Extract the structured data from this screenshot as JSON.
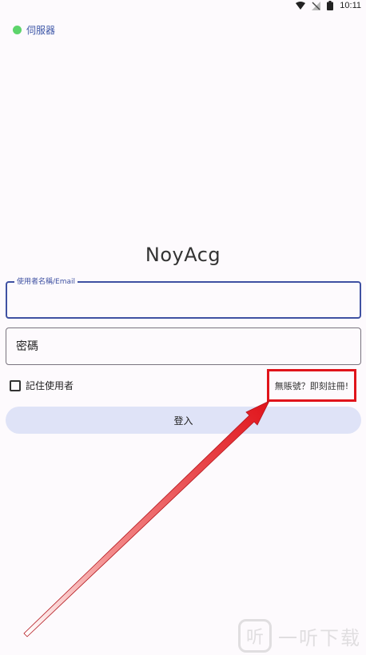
{
  "status_bar": {
    "time": "10:11",
    "icons": [
      "wifi-icon",
      "no-signal-icon",
      "battery-icon"
    ]
  },
  "server": {
    "status_color": "#5dd46b",
    "label": "伺服器"
  },
  "app": {
    "title": "NoyAcg"
  },
  "form": {
    "username_label": "使用者名稱/Email",
    "username_value": "",
    "password_placeholder": "密碼",
    "remember_label": "記住使用者",
    "remember_checked": false,
    "register_link": "無賬號？即刻註冊!",
    "login_button": "登入"
  },
  "annotation": {
    "highlight_color": "#e0141b"
  },
  "watermark": {
    "logo_glyph": "听",
    "text": "一听下载"
  }
}
